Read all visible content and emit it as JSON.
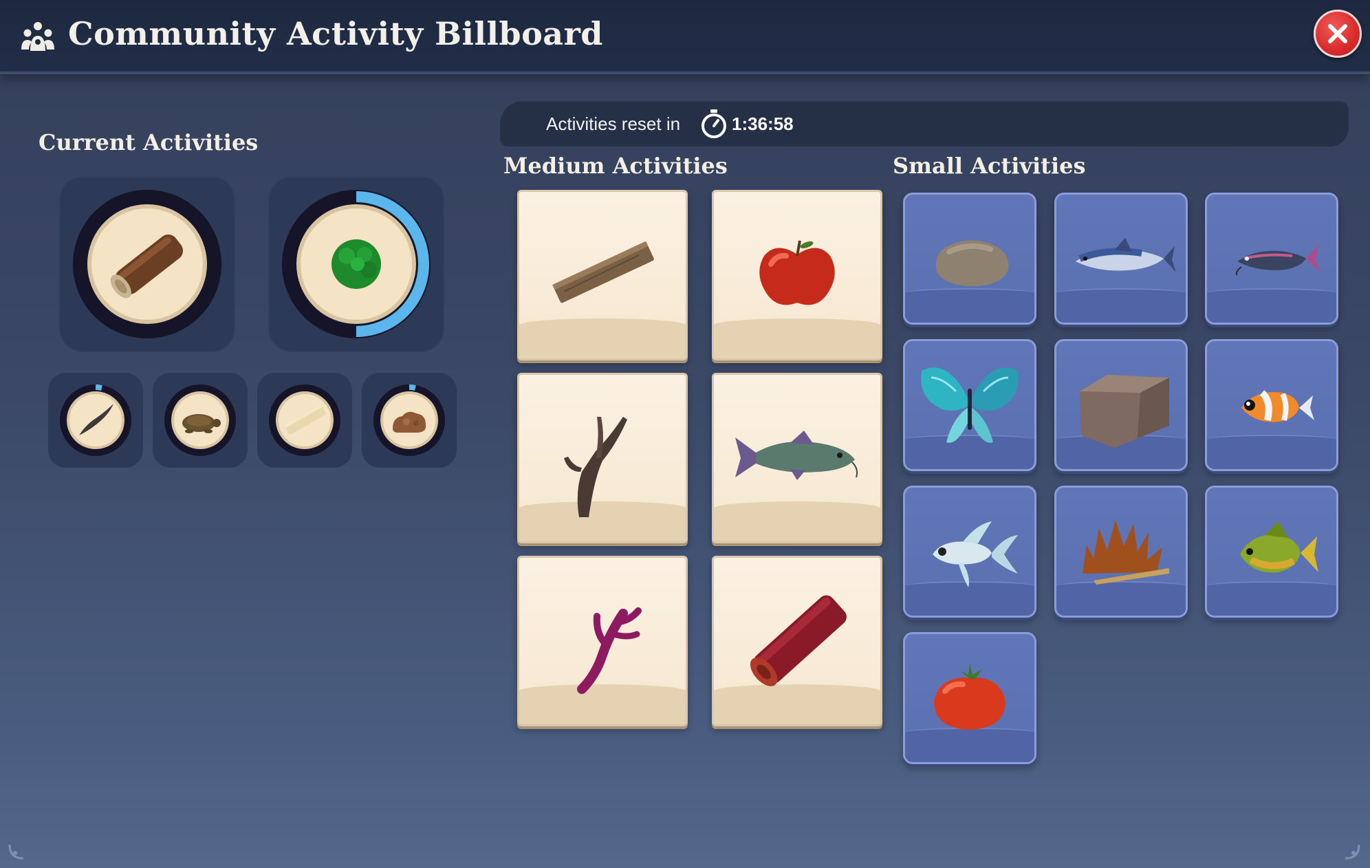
{
  "window": {
    "title": "Community Activity Billboard",
    "title_icon": "community-icon",
    "close_icon": "close-icon"
  },
  "current": {
    "heading": "Current Activities",
    "big": [
      {
        "item": "wood-log",
        "icon": "wood-log-icon",
        "progress": 0.0
      },
      {
        "item": "green-moss",
        "icon": "moss-icon",
        "progress": 0.5
      }
    ],
    "small": [
      {
        "item": "eel",
        "icon": "eel-icon",
        "progress": 0.03
      },
      {
        "item": "turtle",
        "icon": "turtle-icon",
        "progress": 0.0
      },
      {
        "item": "plank",
        "icon": "plank-icon",
        "progress": 0.0
      },
      {
        "item": "clay-rock",
        "icon": "clay-icon",
        "progress": 0.03
      }
    ]
  },
  "reset": {
    "label": "Activities reset in",
    "time": "1:36:58",
    "icon": "timer-icon"
  },
  "medium": {
    "heading": "Medium Activities",
    "items": [
      {
        "item": "wooden-plank",
        "icon": "wooden-plank-icon"
      },
      {
        "item": "red-apple",
        "icon": "apple-icon"
      },
      {
        "item": "antler-branch",
        "icon": "branch-icon"
      },
      {
        "item": "catfish",
        "icon": "catfish-icon"
      },
      {
        "item": "purple-coral",
        "icon": "coral-icon"
      },
      {
        "item": "crimson-log",
        "icon": "crimson-log-icon"
      }
    ]
  },
  "small": {
    "heading": "Small Activities",
    "items": [
      {
        "item": "stone",
        "icon": "stone-icon"
      },
      {
        "item": "blue-trout",
        "icon": "trout-icon"
      },
      {
        "item": "rainbow-fish",
        "icon": "fish-dark-icon"
      },
      {
        "item": "blue-butterfly",
        "icon": "butterfly-icon"
      },
      {
        "item": "stone-block",
        "icon": "stone-block-icon"
      },
      {
        "item": "orange-fish",
        "icon": "orange-fish-icon"
      },
      {
        "item": "ghost-fish",
        "icon": "ghost-fish-icon"
      },
      {
        "item": "dry-leaves",
        "icon": "leaves-icon"
      },
      {
        "item": "green-fish",
        "icon": "green-fish-icon"
      },
      {
        "item": "tomato",
        "icon": "tomato-icon"
      }
    ]
  },
  "colors": {
    "accent_progress": "#5bb6ec",
    "close_red": "#d92b2b",
    "parchment": "#f6e7d0",
    "card_blue": "#5a70b0"
  }
}
